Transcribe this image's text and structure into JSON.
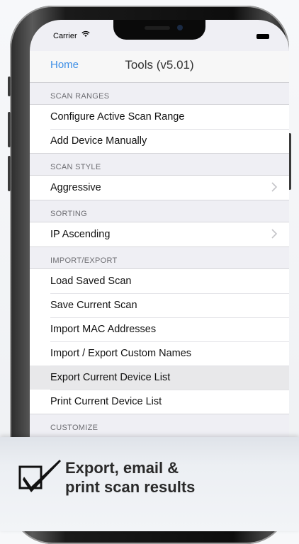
{
  "status_bar": {
    "carrier": "Carrier"
  },
  "nav": {
    "back_label": "Home",
    "title": "Tools (v5.01)"
  },
  "sections": [
    {
      "header": "SCAN RANGES",
      "rows": [
        {
          "label": "Configure Active Scan Range"
        },
        {
          "label": "Add Device Manually"
        }
      ]
    },
    {
      "header": "SCAN STYLE",
      "rows": [
        {
          "label": "Aggressive"
        }
      ]
    },
    {
      "header": "SORTING",
      "rows": [
        {
          "label": "IP Ascending"
        }
      ]
    },
    {
      "header": "IMPORT/EXPORT",
      "rows": [
        {
          "label": "Load Saved Scan"
        },
        {
          "label": "Save Current Scan"
        },
        {
          "label": "Import MAC Addresses"
        },
        {
          "label": "Import / Export Custom Names"
        },
        {
          "label": "Export Current Device List"
        },
        {
          "label": "Print Current Device List"
        }
      ]
    },
    {
      "header": "CUSTOMIZE",
      "rows": []
    }
  ],
  "banner": {
    "line1": "Export, email &",
    "line2": "print scan results"
  },
  "colors": {
    "accent": "#3c8ee6",
    "background": "#efeff4"
  },
  "icons": {
    "wifi": "wifi-icon",
    "battery": "battery-icon",
    "chevron": "chevron-right-icon",
    "checkbox": "checkbox-checked-icon"
  }
}
